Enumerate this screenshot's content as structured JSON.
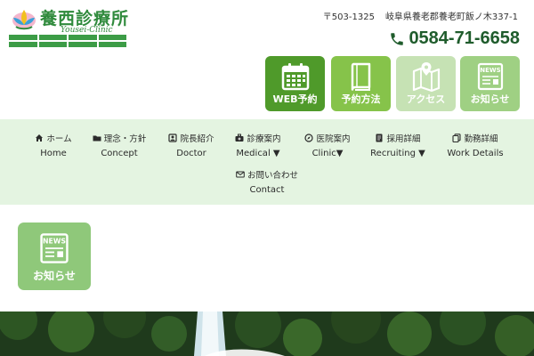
{
  "logo": {
    "title": "養西診療所",
    "subtitle": "Yousei-Clinic",
    "tags": [
      "",
      "",
      "",
      "",
      "",
      "",
      "",
      ""
    ]
  },
  "contact": {
    "postal": "〒503-1325",
    "address": "岐阜県養老郡養老町飯ノ木337-1",
    "phone": "0584-71-6658"
  },
  "quick_links": [
    {
      "label": "WEB予約",
      "icon": "calendar-icon"
    },
    {
      "label": "予約方法",
      "icon": "book-icon"
    },
    {
      "label": "アクセス",
      "icon": "map-icon"
    },
    {
      "label": "お知らせ",
      "icon": "newspaper-icon"
    }
  ],
  "nav": [
    {
      "ja": "ホーム",
      "en": "Home",
      "icon": "home-icon"
    },
    {
      "ja": "理念・方針",
      "en": "Concept",
      "icon": "folder-icon"
    },
    {
      "ja": "院長紹介",
      "en": "Doctor",
      "icon": "profile-icon"
    },
    {
      "ja": "診療案内",
      "en": "Medical ▼",
      "icon": "medical-bag-icon"
    },
    {
      "ja": "医院案内",
      "en": "Clinic▼",
      "icon": "compass-icon"
    },
    {
      "ja": "採用詳細",
      "en": "Recruiting ▼",
      "icon": "document-icon"
    },
    {
      "ja": "勤務詳細",
      "en": "Work Details",
      "icon": "copy-icon"
    },
    {
      "ja": "お問い合わせ",
      "en": "Contact",
      "icon": "mail-icon"
    }
  ],
  "news_button": {
    "label": "お知らせ",
    "icon": "newspaper-icon"
  },
  "colors": {
    "brand_green": "#2f8a3c",
    "nav_background": "#e4f4e1",
    "web_reserve": "#4f9a2a",
    "reserve_method": "#86c34a",
    "access": "#c6e2b4",
    "news": "#9fd083"
  }
}
